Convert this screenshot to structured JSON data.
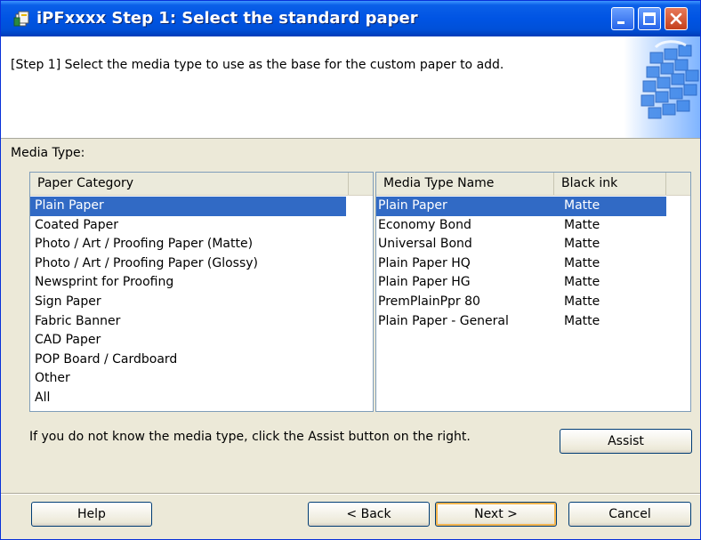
{
  "window": {
    "title": "iPFxxxx  Step 1: Select the standard paper",
    "controls": [
      "minimize-icon",
      "maximize-icon",
      "close-icon"
    ]
  },
  "header": {
    "instruction": "[Step 1] Select the media type to use as the base for the custom paper to add."
  },
  "media_type_label": "Media Type:",
  "category_list": {
    "column_header": "Paper Category",
    "selected_index": 0,
    "items": [
      "Plain Paper",
      "Coated Paper",
      "Photo / Art / Proofing Paper (Matte)",
      "Photo / Art / Proofing Paper (Glossy)",
      "Newsprint for Proofing",
      "Sign Paper",
      "Fabric Banner",
      "CAD Paper",
      "POP Board / Cardboard",
      "Other",
      "All"
    ]
  },
  "media_list": {
    "columns": [
      "Media Type Name",
      "Black ink"
    ],
    "selected_index": 0,
    "rows": [
      {
        "name": "Plain Paper",
        "ink": "Matte"
      },
      {
        "name": "Economy Bond",
        "ink": "Matte"
      },
      {
        "name": "Universal Bond",
        "ink": "Matte"
      },
      {
        "name": "Plain Paper HQ",
        "ink": "Matte"
      },
      {
        "name": "Plain Paper HG",
        "ink": "Matte"
      },
      {
        "name": "PremPlainPpr 80",
        "ink": "Matte"
      },
      {
        "name": "Plain Paper - General",
        "ink": "Matte"
      }
    ]
  },
  "hint": "If you do not know the media type, click the Assist button on the right.",
  "buttons": {
    "assist": "Assist",
    "help": "Help",
    "back": "< Back",
    "next": "Next >",
    "cancel": "Cancel"
  },
  "colors": {
    "title_bar": "#0054e3",
    "selection": "#316ac5",
    "dialog_bg": "#ece9d8",
    "default_button_ring": "#f4b54f"
  }
}
